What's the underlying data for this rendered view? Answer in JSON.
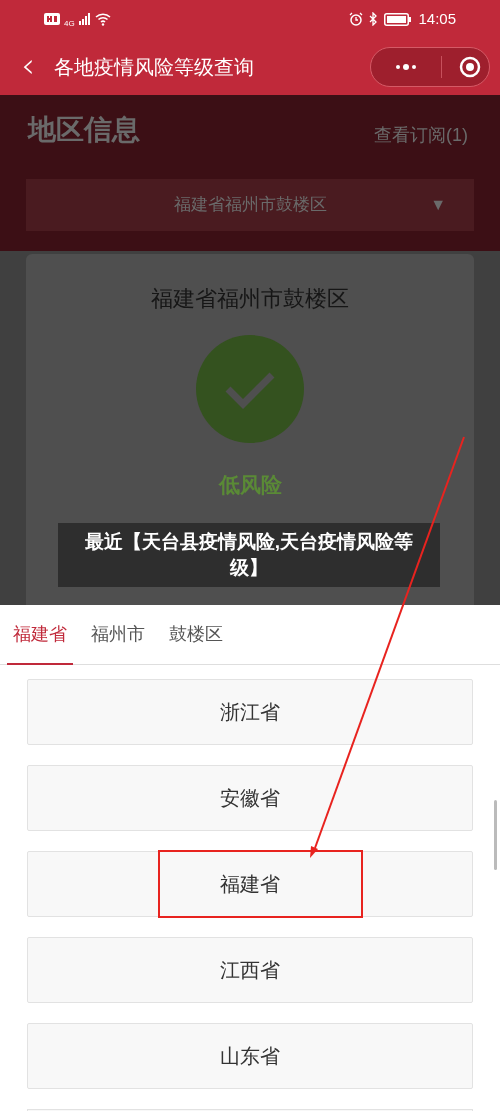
{
  "status_bar": {
    "network": "4G",
    "time": "14:05"
  },
  "nav": {
    "back": "‹",
    "title": "各地疫情风险等级查询"
  },
  "region": {
    "heading": "地区信息",
    "subscription_link": "查看订阅(1)",
    "dropdown": "福建省福州市鼓楼区",
    "dropdown_caret": "▼"
  },
  "risk_card": {
    "place": "福建省福州市鼓楼区",
    "level": "低风险"
  },
  "caption": "最近【天台县疫情风险,天台疫情风险等级】",
  "picker": {
    "tabs": [
      {
        "label": "福建省",
        "selected": true
      },
      {
        "label": "福州市",
        "selected": false
      },
      {
        "label": "鼓楼区",
        "selected": false
      }
    ],
    "options": [
      {
        "label": "浙江省",
        "highlighted": false
      },
      {
        "label": "安徽省",
        "highlighted": false
      },
      {
        "label": "福建省",
        "highlighted": true
      },
      {
        "label": "江西省",
        "highlighted": false
      },
      {
        "label": "山东省",
        "highlighted": false
      }
    ]
  }
}
